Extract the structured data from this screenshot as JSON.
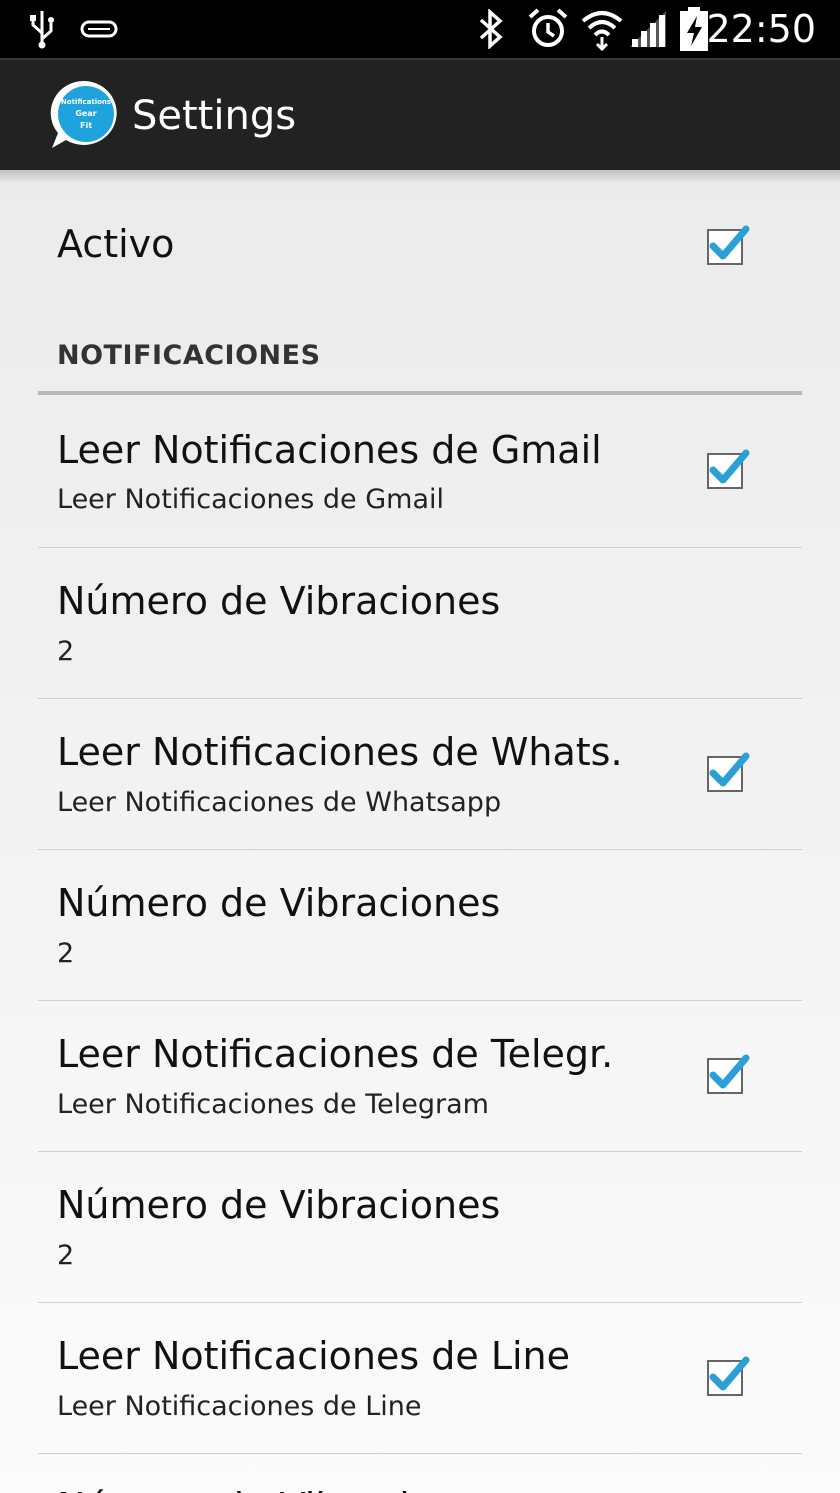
{
  "status_bar": {
    "time": "22:50",
    "icons": [
      "usb-icon",
      "sd-card-icon",
      "bluetooth-icon",
      "alarm-icon",
      "wifi-icon",
      "signal-icon",
      "battery-charging-icon"
    ]
  },
  "action_bar": {
    "title": "Settings",
    "app_icon": {
      "name": "gear-fit-notifications-logo",
      "lines": [
        "Notifications",
        "Gear",
        "Fit"
      ]
    }
  },
  "colors": {
    "checkbox_check": "#2a9fd8",
    "action_bar_bg": "#222222",
    "status_bar_bg": "#000000"
  },
  "preferences": [
    {
      "type": "checkbox",
      "title": "Activo",
      "checked": true
    }
  ],
  "category": {
    "label": "NOTIFICACIONES"
  },
  "items": [
    {
      "type": "checkbox",
      "title": "Leer Notificaciones de Gmail",
      "summary": "Leer Notificaciones de Gmail",
      "checked": true
    },
    {
      "type": "list",
      "title": "Número de Vibraciones",
      "summary": "2"
    },
    {
      "type": "checkbox",
      "title": "Leer Notificaciones de Whats.",
      "summary": "Leer Notificaciones de Whatsapp",
      "checked": true
    },
    {
      "type": "list",
      "title": "Número de Vibraciones",
      "summary": "2"
    },
    {
      "type": "checkbox",
      "title": "Leer Notificaciones de Telegr.",
      "summary": "Leer Notificaciones de Telegram",
      "checked": true
    },
    {
      "type": "list",
      "title": "Número de Vibraciones",
      "summary": "2"
    },
    {
      "type": "checkbox",
      "title": "Leer Notificaciones de Line",
      "summary": "Leer Notificaciones de Line",
      "checked": true
    },
    {
      "type": "list",
      "title": "Número de Vibraciones",
      "summary": ""
    }
  ]
}
